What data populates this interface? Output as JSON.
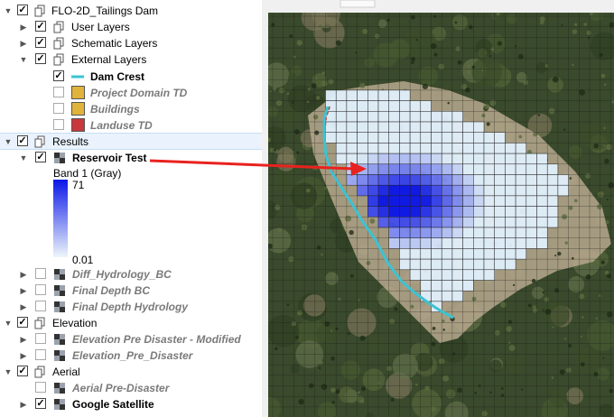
{
  "layers_panel": {
    "project": "FLO-2D_Tailings Dam",
    "items": [
      {
        "label": "User Layers",
        "type": "group",
        "checked": true,
        "icon": "layer-group-icon"
      },
      {
        "label": "Schematic Layers",
        "type": "group",
        "checked": true,
        "icon": "layer-group-icon"
      },
      {
        "label": "External Layers",
        "type": "group",
        "checked": true,
        "expanded": true,
        "icon": "layer-group-icon"
      },
      {
        "label": "Dam Crest",
        "type": "line-layer",
        "checked": true,
        "color": "#3cc3d3"
      },
      {
        "label": "Project Domain TD",
        "type": "polygon-layer",
        "checked": false,
        "color": "#e0b43a"
      },
      {
        "label": "Buildings",
        "type": "polygon-layer",
        "checked": false,
        "color": "#e0b43a"
      },
      {
        "label": "Landuse TD",
        "type": "polygon-layer",
        "checked": false,
        "color": "#c8383d"
      },
      {
        "label": "Results",
        "type": "group",
        "checked": true,
        "expanded": true,
        "icon": "layer-group-icon"
      },
      {
        "label": "Reservoir Test",
        "type": "raster-layer",
        "checked": true,
        "expanded": true
      },
      {
        "label": "Diff_Hydrology_BC",
        "type": "raster-layer",
        "checked": false
      },
      {
        "label": "Final Depth BC",
        "type": "raster-layer",
        "checked": false
      },
      {
        "label": "Final Depth Hydrology",
        "type": "raster-layer",
        "checked": false
      },
      {
        "label": "Elevation",
        "type": "group",
        "checked": true,
        "expanded": true,
        "icon": "layer-group-icon"
      },
      {
        "label": "Elevation Pre Disaster - Modified",
        "type": "raster-layer",
        "checked": false
      },
      {
        "label": "Elevation_Pre_Disaster",
        "type": "raster-layer",
        "checked": false
      },
      {
        "label": "Aerial",
        "type": "group",
        "checked": true,
        "expanded": true,
        "icon": "layer-group-icon"
      },
      {
        "label": "Aerial Pre-Disaster",
        "type": "raster-layer",
        "checked": false
      },
      {
        "label": "Google Satellite",
        "type": "raster-layer",
        "checked": true
      }
    ],
    "legend": {
      "band": "Band 1 (Gray)",
      "max": "71",
      "min": "0.01",
      "color_high": "#0a17e8",
      "color_low": "#eef6fb"
    }
  },
  "map": {
    "highlight_layer": "Reservoir Test",
    "annotation_arrow_color": "#e8221e",
    "dam_crest_color": "#3cc3d3",
    "landuse_outline_color": "#c8383d"
  }
}
